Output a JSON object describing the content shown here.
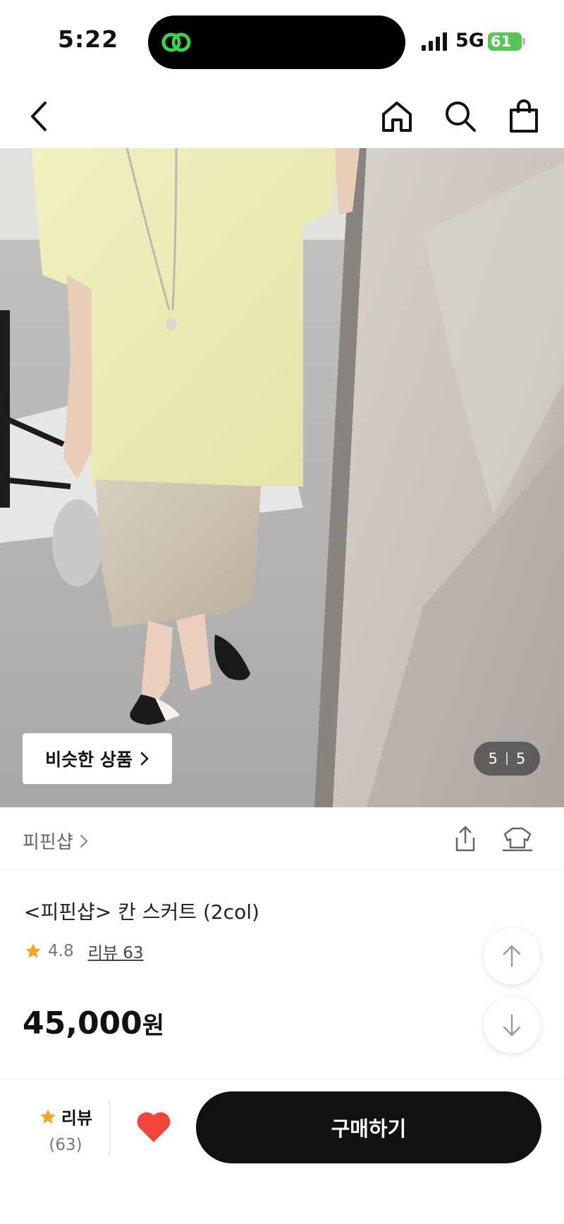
{
  "status_bar": {
    "time": "5:22",
    "network": "5G",
    "battery": "61"
  },
  "icons": {
    "back": "back-arrow-icon",
    "home": "home-icon",
    "search": "search-icon",
    "bag": "shopping-bag-icon",
    "share": "share-icon",
    "closet": "closet-icon",
    "star": "star-icon",
    "heart": "heart-icon",
    "up": "arrow-up-icon",
    "down": "arrow-down-icon"
  },
  "hero": {
    "similar_button": "비슷한 상품",
    "current": "5",
    "total": "5"
  },
  "shop": {
    "name": "피핀샵"
  },
  "product": {
    "title": "<피핀샵> 칸 스커트 (2col)",
    "rating": "4.8",
    "review_link": "리뷰 63",
    "price": "45,000",
    "currency": "원"
  },
  "bottom_bar": {
    "review_label": "리뷰",
    "review_count": "(63)",
    "buy_label": "구매하기",
    "heart_color": "#f0443c",
    "star_color": "#f5a623"
  }
}
